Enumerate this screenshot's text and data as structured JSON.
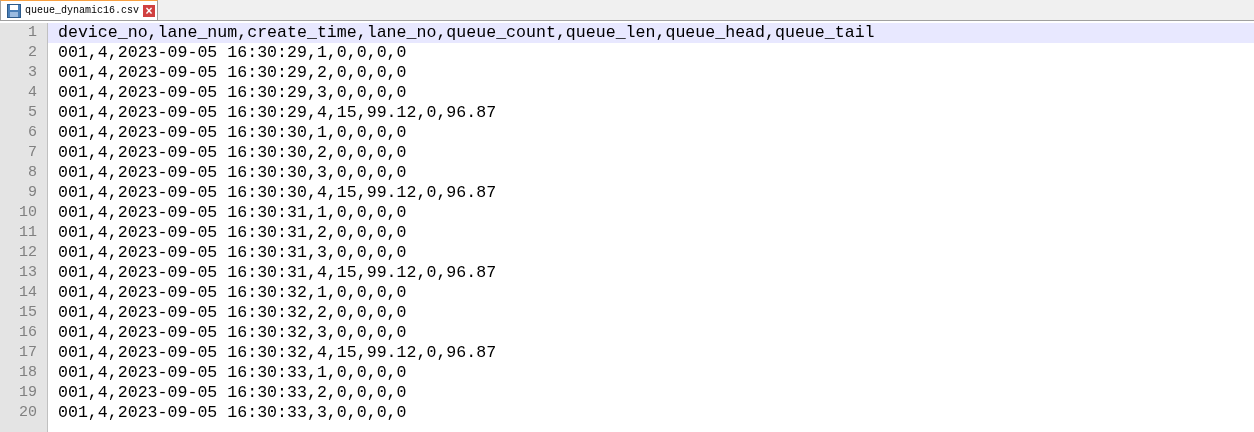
{
  "tabs": [
    {
      "label": "queue_dynamic16.csv",
      "selected": true,
      "close": "×"
    }
  ],
  "lines": [
    {
      "number": "1",
      "text": "device_no,lane_num,create_time,lane_no,queue_count,queue_len,queue_head,queue_tail",
      "current": true
    },
    {
      "number": "2",
      "text": "001,4,2023-09-05 16:30:29,1,0,0,0,0",
      "current": false
    },
    {
      "number": "3",
      "text": "001,4,2023-09-05 16:30:29,2,0,0,0,0",
      "current": false
    },
    {
      "number": "4",
      "text": "001,4,2023-09-05 16:30:29,3,0,0,0,0",
      "current": false
    },
    {
      "number": "5",
      "text": "001,4,2023-09-05 16:30:29,4,15,99.12,0,96.87",
      "current": false
    },
    {
      "number": "6",
      "text": "001,4,2023-09-05 16:30:30,1,0,0,0,0",
      "current": false
    },
    {
      "number": "7",
      "text": "001,4,2023-09-05 16:30:30,2,0,0,0,0",
      "current": false
    },
    {
      "number": "8",
      "text": "001,4,2023-09-05 16:30:30,3,0,0,0,0",
      "current": false
    },
    {
      "number": "9",
      "text": "001,4,2023-09-05 16:30:30,4,15,99.12,0,96.87",
      "current": false
    },
    {
      "number": "10",
      "text": "001,4,2023-09-05 16:30:31,1,0,0,0,0",
      "current": false
    },
    {
      "number": "11",
      "text": "001,4,2023-09-05 16:30:31,2,0,0,0,0",
      "current": false
    },
    {
      "number": "12",
      "text": "001,4,2023-09-05 16:30:31,3,0,0,0,0",
      "current": false
    },
    {
      "number": "13",
      "text": "001,4,2023-09-05 16:30:31,4,15,99.12,0,96.87",
      "current": false
    },
    {
      "number": "14",
      "text": "001,4,2023-09-05 16:30:32,1,0,0,0,0",
      "current": false
    },
    {
      "number": "15",
      "text": "001,4,2023-09-05 16:30:32,2,0,0,0,0",
      "current": false
    },
    {
      "number": "16",
      "text": "001,4,2023-09-05 16:30:32,3,0,0,0,0",
      "current": false
    },
    {
      "number": "17",
      "text": "001,4,2023-09-05 16:30:32,4,15,99.12,0,96.87",
      "current": false
    },
    {
      "number": "18",
      "text": "001,4,2023-09-05 16:30:33,1,0,0,0,0",
      "current": false
    },
    {
      "number": "19",
      "text": "001,4,2023-09-05 16:30:33,2,0,0,0,0",
      "current": false
    },
    {
      "number": "20",
      "text": "001,4,2023-09-05 16:30:33,3,0,0,0,0",
      "current": false
    }
  ]
}
